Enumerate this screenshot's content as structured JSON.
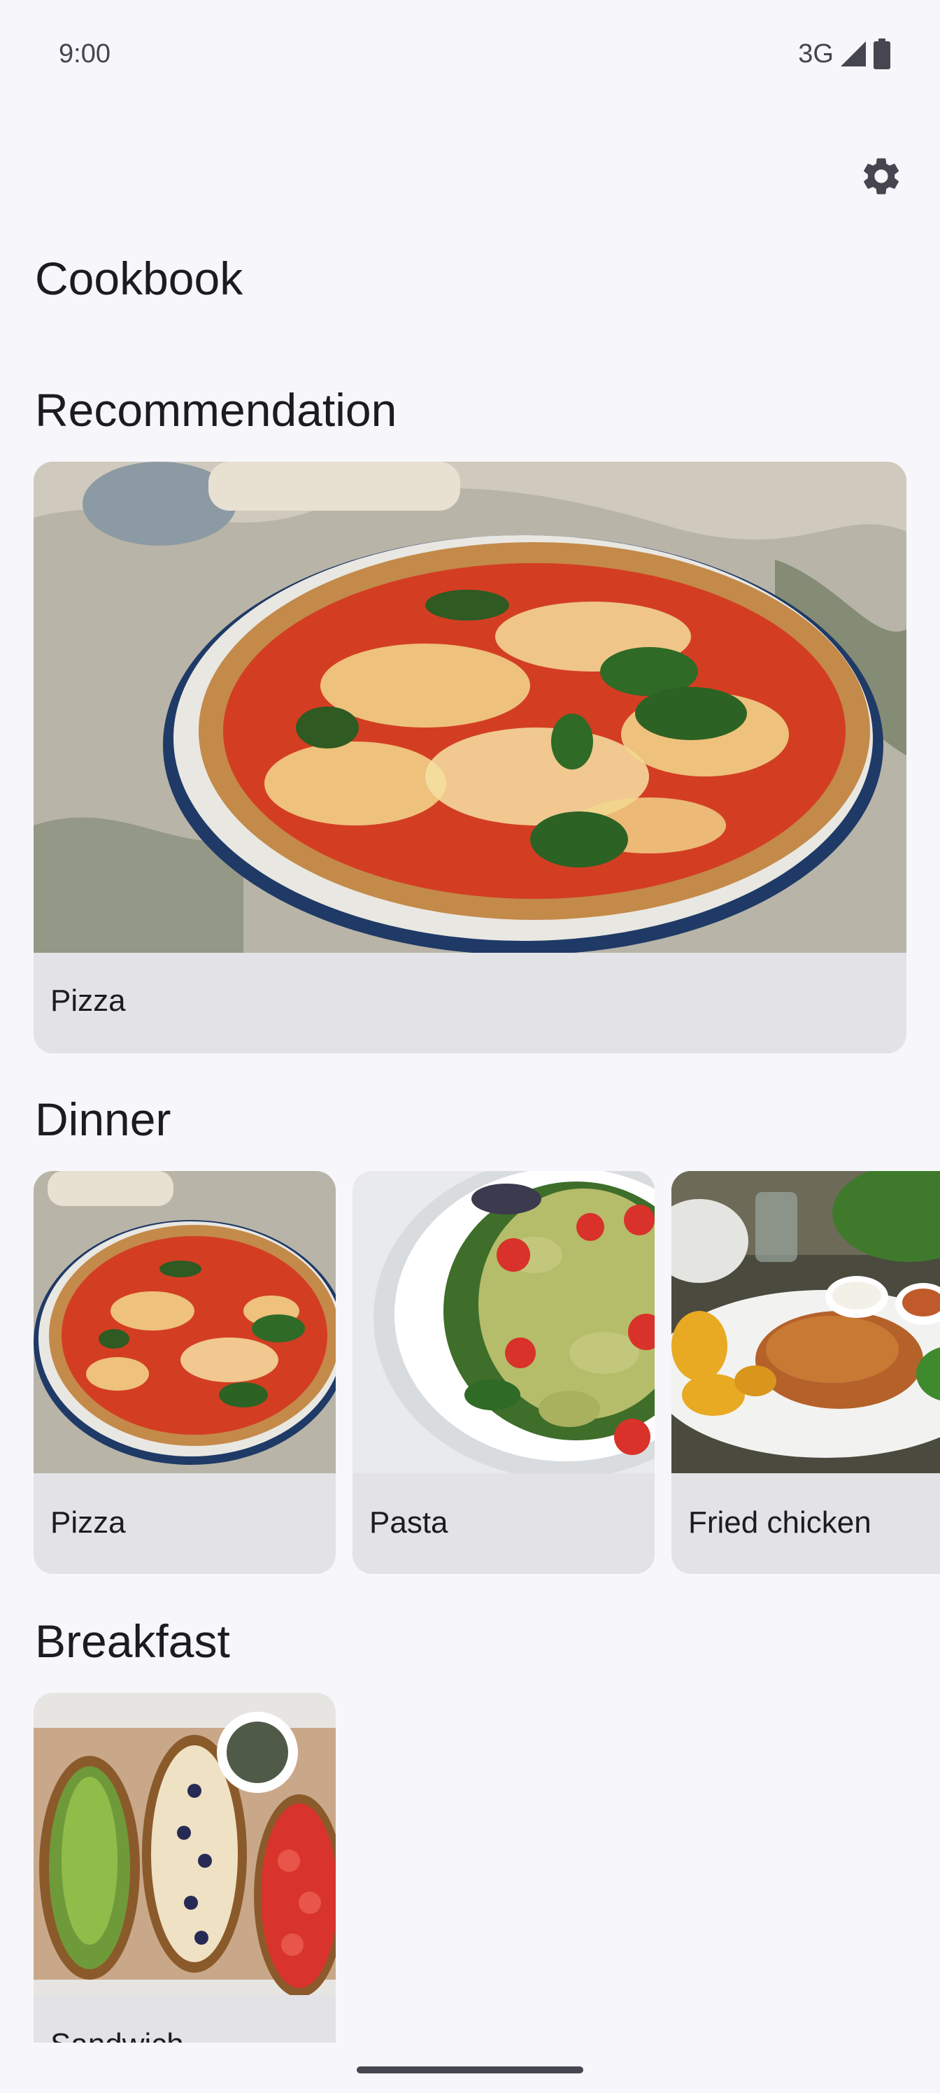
{
  "status": {
    "time": "9:00",
    "network": "3G"
  },
  "app": {
    "title": "Cookbook",
    "settings_icon": "gear-icon"
  },
  "sections": {
    "recommendation": {
      "title": "Recommendation",
      "items": [
        {
          "label": "Pizza"
        }
      ]
    },
    "dinner": {
      "title": "Dinner",
      "items": [
        {
          "label": "Pizza"
        },
        {
          "label": "Pasta"
        },
        {
          "label": "Fried chicken"
        }
      ]
    },
    "breakfast": {
      "title": "Breakfast",
      "items": [
        {
          "label": "Sandwich"
        }
      ]
    }
  },
  "colors": {
    "background": "#f7f6fb",
    "card_footer": "#e3e2e6",
    "text": "#1d1b20",
    "icon": "#45464f"
  }
}
